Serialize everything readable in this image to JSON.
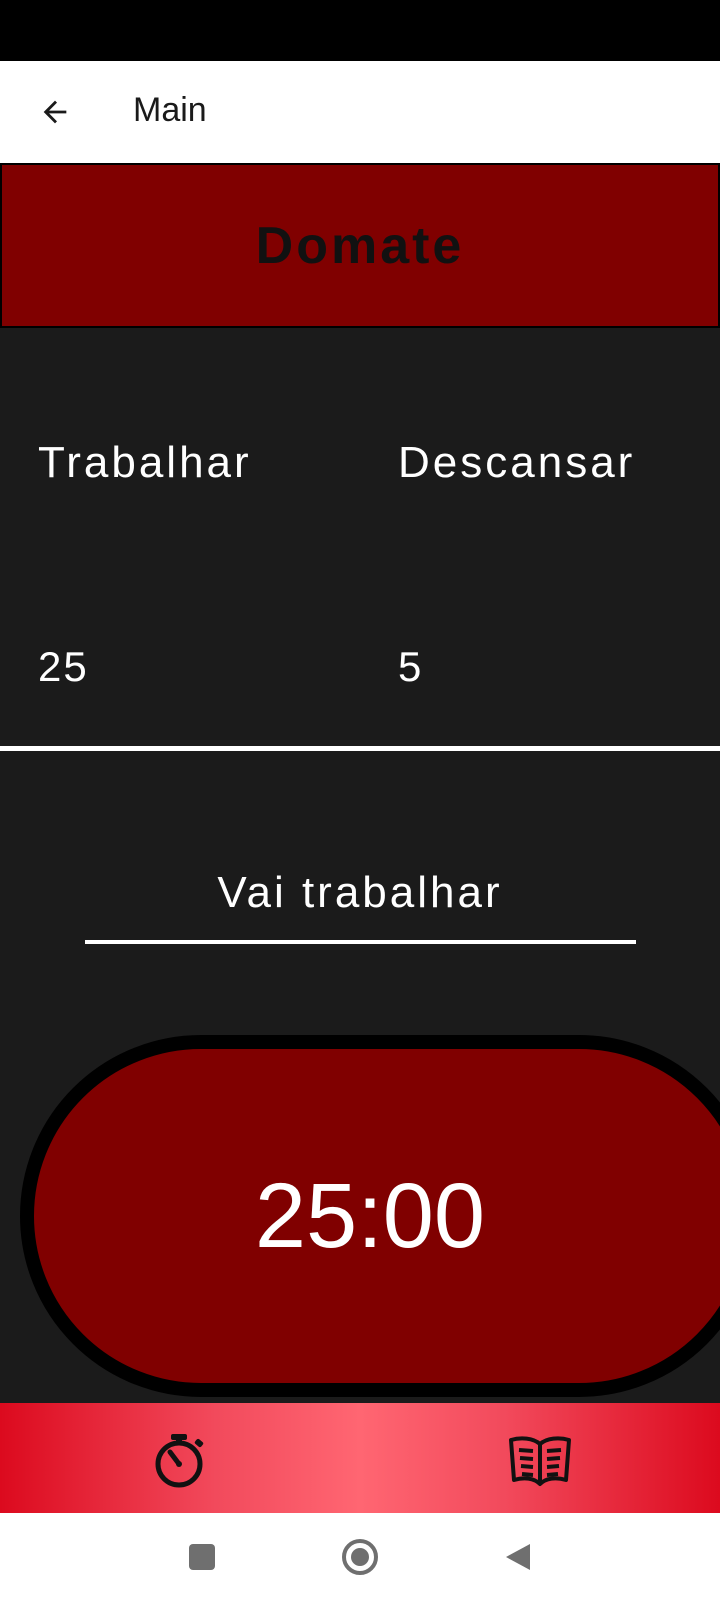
{
  "app_bar": {
    "title": "Main",
    "back_icon": "arrow-left-icon"
  },
  "banner": {
    "title": "Domate"
  },
  "settings": {
    "work": {
      "label": "Trabalhar",
      "value": "25"
    },
    "rest": {
      "label": "Descansar",
      "value": "5"
    }
  },
  "status": {
    "text": "Vai trabalhar"
  },
  "timer": {
    "display": "25:00"
  },
  "bottom_nav": {
    "items": [
      {
        "icon": "stopwatch-icon"
      },
      {
        "icon": "book-open-icon"
      }
    ]
  },
  "system_nav": {
    "items": [
      "recents-square-icon",
      "home-circle-icon",
      "back-triangle-icon"
    ]
  },
  "colors": {
    "banner": "#800000",
    "background": "#1b1b1b",
    "nav_edge": "#dc0a1e",
    "nav_center": "#ff6672"
  }
}
